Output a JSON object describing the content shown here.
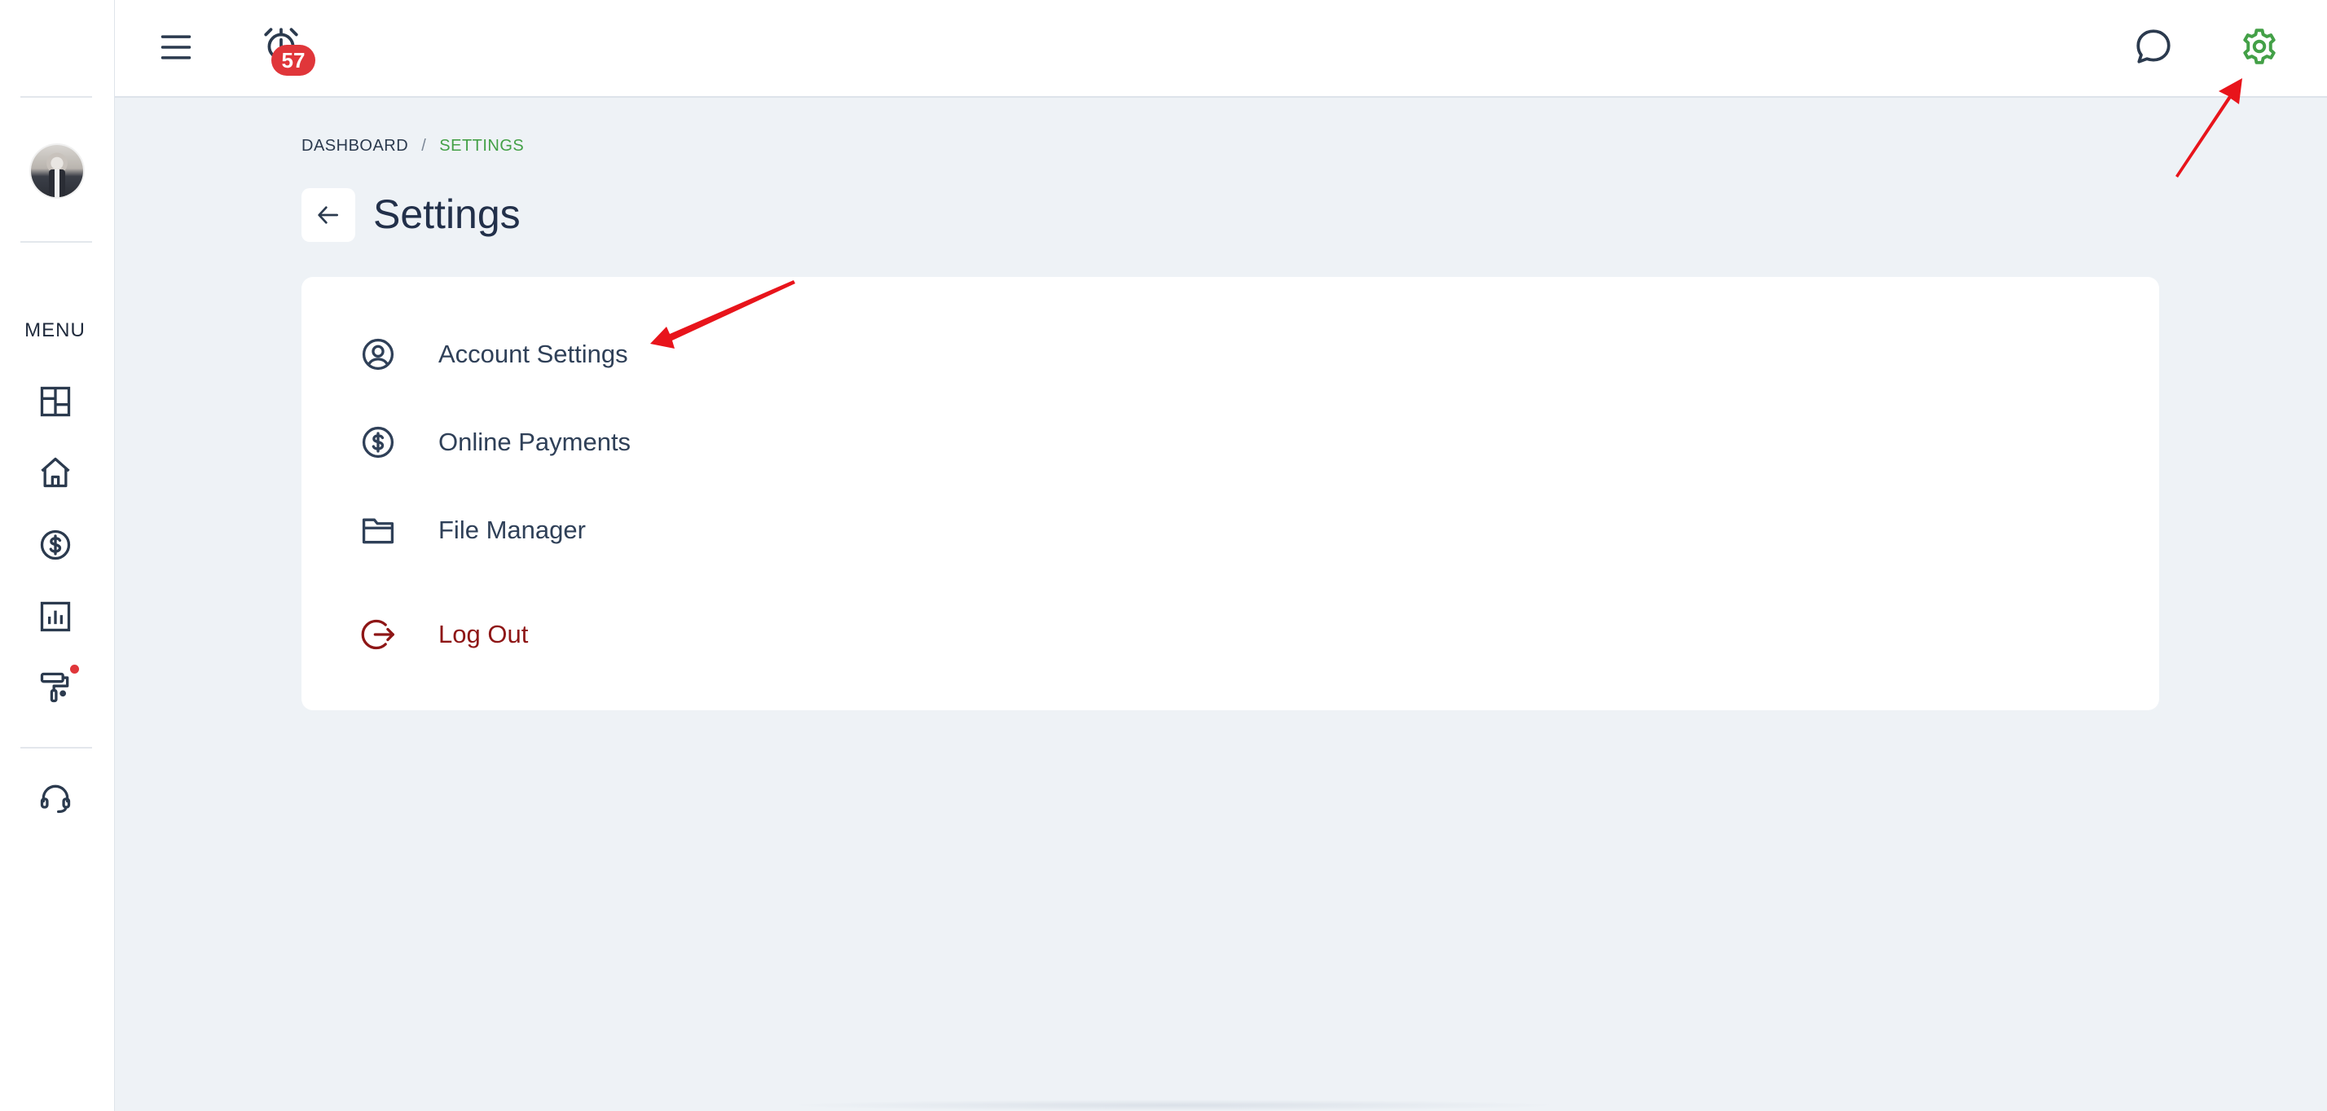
{
  "topbar": {
    "alarm_count": "57"
  },
  "sidebar": {
    "menu_label": "MENU",
    "items": [
      {
        "icon": "dashboard-icon"
      },
      {
        "icon": "home-icon"
      },
      {
        "icon": "dollar-circle-icon"
      },
      {
        "icon": "chart-icon"
      },
      {
        "icon": "paint-roller-icon",
        "has_notification": true
      },
      {
        "icon": "headset-icon"
      }
    ]
  },
  "breadcrumb": {
    "items": [
      "DASHBOARD",
      "SETTINGS"
    ],
    "separator": "/"
  },
  "page": {
    "title": "Settings"
  },
  "settings_menu": [
    {
      "label": "Account Settings",
      "icon": "user-circle-icon"
    },
    {
      "label": "Online Payments",
      "icon": "dollar-circle-icon"
    },
    {
      "label": "File Manager",
      "icon": "folder-icon"
    },
    {
      "label": "Log Out",
      "icon": "logout-icon"
    }
  ],
  "colors": {
    "accent_green": "#43a047",
    "logout_red": "#8e1616",
    "badge_red": "#e0363a",
    "background": "#eef2f6"
  }
}
